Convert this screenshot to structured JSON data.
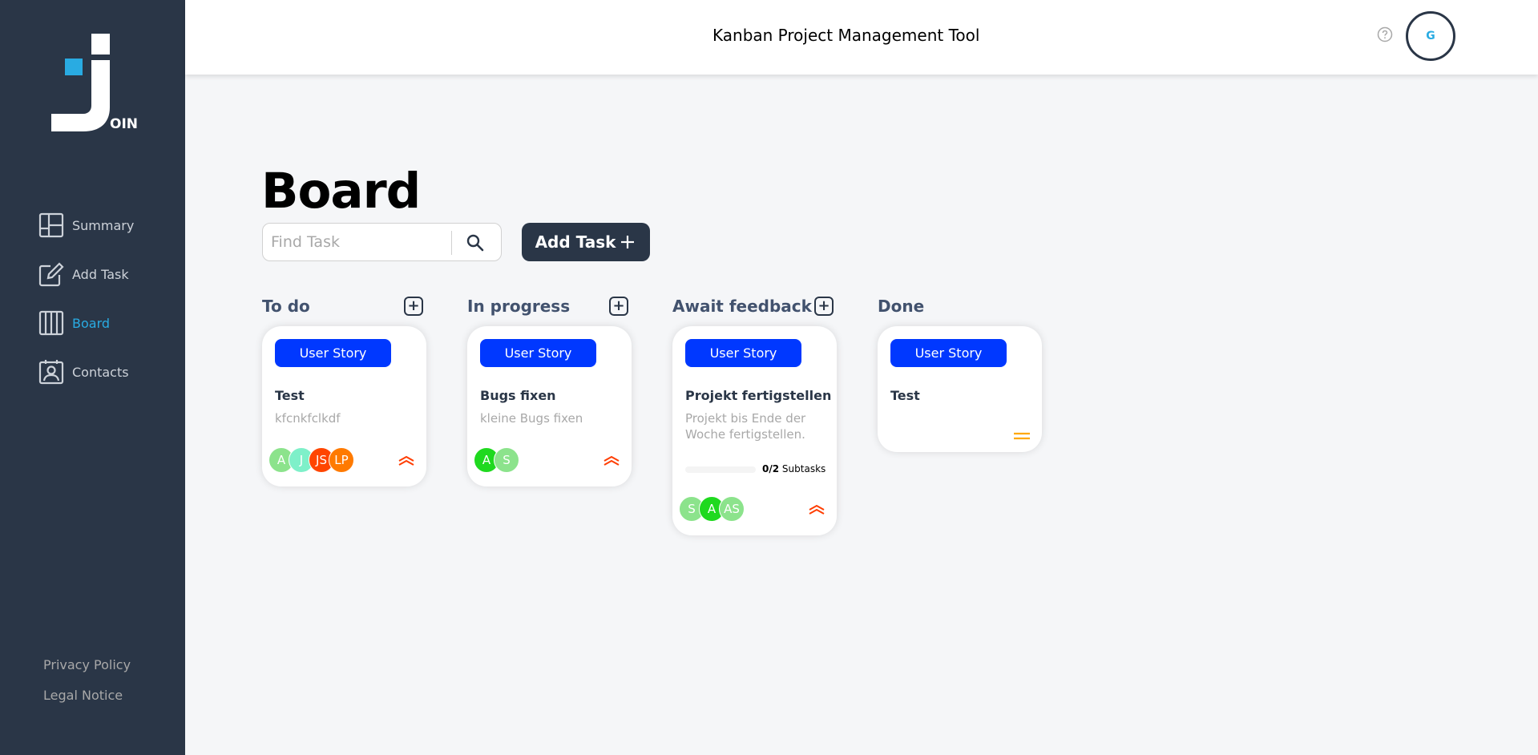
{
  "app": {
    "header_title": "Kanban Project Management Tool",
    "user_initials": "G",
    "logo_suffix": "OIN"
  },
  "sidebar": {
    "items": [
      {
        "label": "Summary",
        "icon": "summary-icon",
        "active": false
      },
      {
        "label": "Add Task",
        "icon": "edit-icon",
        "active": false
      },
      {
        "label": "Board",
        "icon": "board-icon",
        "active": true
      },
      {
        "label": "Contacts",
        "icon": "contacts-icon",
        "active": false
      }
    ],
    "footer": {
      "privacy": "Privacy Policy",
      "legal": "Legal Notice"
    }
  },
  "board": {
    "title": "Board",
    "search_placeholder": "Find Task",
    "add_task_label": "Add Task",
    "columns": [
      {
        "title": "To do"
      },
      {
        "title": "In progress"
      },
      {
        "title": "Await feedback"
      },
      {
        "title": "Done"
      }
    ],
    "cards": [
      {
        "tag": "User Story",
        "title": "Test",
        "description": "kfcnkfclkdf",
        "avatars": [
          {
            "initials": "A",
            "color": "#8ce38c"
          },
          {
            "initials": "J",
            "color": "#7ef0c9"
          },
          {
            "initials": "JS",
            "color": "#ff4500"
          },
          {
            "initials": "LP",
            "color": "#ff7a00"
          }
        ],
        "priority": "urgent"
      },
      {
        "tag": "User Story",
        "title": "Bugs fixen",
        "description": "kleine Bugs fixen",
        "avatars": [
          {
            "initials": "A",
            "color": "#1fd91f"
          },
          {
            "initials": "S",
            "color": "#8ce38c"
          }
        ],
        "priority": "urgent"
      },
      {
        "tag": "User Story",
        "title": "Projekt fertigstellen",
        "description": "Projekt bis Ende der Woche fertigstellen.",
        "subtasks_done": "0",
        "subtasks_total": "/2",
        "subtasks_label": "Subtasks",
        "avatars": [
          {
            "initials": "S",
            "color": "#8ce38c"
          },
          {
            "initials": "A",
            "color": "#1fd91f"
          },
          {
            "initials": "AS",
            "color": "#8ce38c"
          }
        ],
        "priority": "urgent"
      },
      {
        "tag": "User Story",
        "title": "Test",
        "description": "",
        "avatars": [],
        "priority": "medium"
      }
    ]
  },
  "colors": {
    "sidebar_bg": "#2a3647",
    "accent": "#29abe2",
    "tag_blue": "#0038ff",
    "urgent": "#ff3d00",
    "medium": "#ffa800"
  }
}
